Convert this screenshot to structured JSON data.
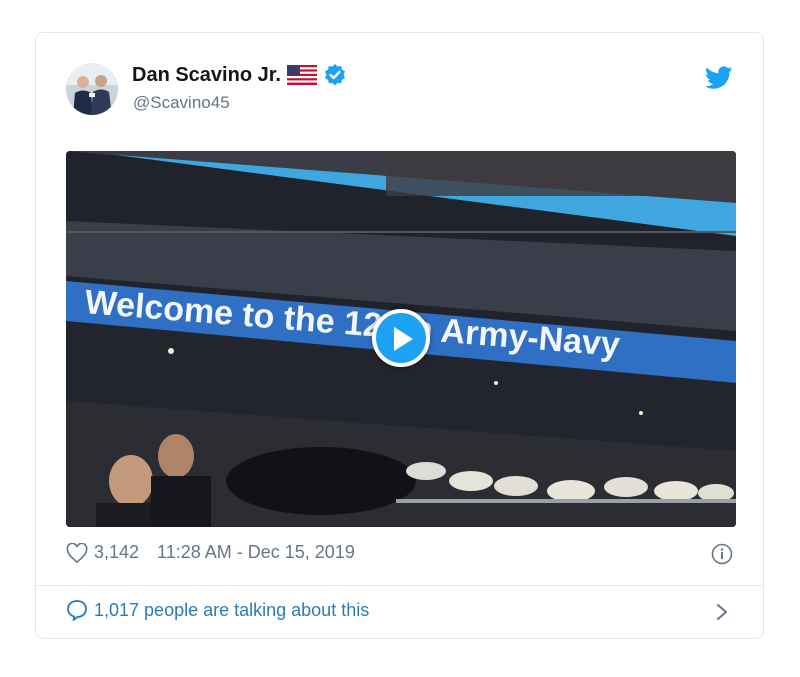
{
  "tweet": {
    "display_name": "Dan Scavino Jr.",
    "handle": "@Scavino45",
    "likes": "3,142",
    "timestamp": "11:28 AM - Dec 15, 2019",
    "talking": "1,017 people are talking about this"
  },
  "media": {
    "banner_text": "Welcome to the 120th Army-Navy"
  },
  "colors": {
    "accent": "#1da1f2",
    "link": "#2b7bb9",
    "muted": "#657786",
    "border": "#e1e8ed"
  },
  "icons": [
    "avatar-photo",
    "us-flag-icon",
    "verified-badge-icon",
    "twitter-bird-icon",
    "play-icon",
    "heart-icon",
    "info-icon",
    "reply-bubble-icon",
    "chevron-right-icon"
  ]
}
